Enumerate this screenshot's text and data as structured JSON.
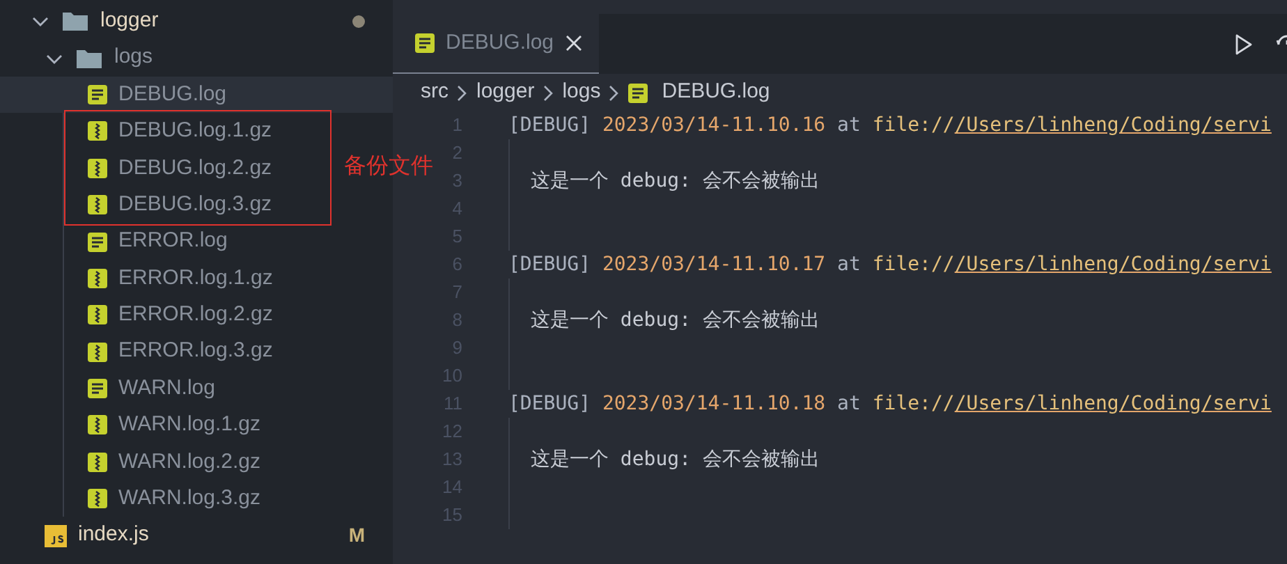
{
  "sidebar": {
    "tree": [
      {
        "label": "logger",
        "kind": "folder",
        "expanded": true,
        "modified_dot": true,
        "children": [
          {
            "label": "logs",
            "kind": "folder",
            "expanded": true,
            "children": [
              {
                "label": "DEBUG.log",
                "kind": "log",
                "selected": true,
                "in_annotation": false
              },
              {
                "label": "DEBUG.log.1.gz",
                "kind": "archive",
                "selected": false,
                "in_annotation": true
              },
              {
                "label": "DEBUG.log.2.gz",
                "kind": "archive",
                "selected": false,
                "in_annotation": true
              },
              {
                "label": "DEBUG.log.3.gz",
                "kind": "archive",
                "selected": false,
                "in_annotation": true
              },
              {
                "label": "ERROR.log",
                "kind": "log",
                "selected": false,
                "in_annotation": false
              },
              {
                "label": "ERROR.log.1.gz",
                "kind": "archive",
                "selected": false,
                "in_annotation": false
              },
              {
                "label": "ERROR.log.2.gz",
                "kind": "archive",
                "selected": false,
                "in_annotation": false
              },
              {
                "label": "ERROR.log.3.gz",
                "kind": "archive",
                "selected": false,
                "in_annotation": false
              },
              {
                "label": "WARN.log",
                "kind": "log",
                "selected": false,
                "in_annotation": false
              },
              {
                "label": "WARN.log.1.gz",
                "kind": "archive",
                "selected": false,
                "in_annotation": false
              },
              {
                "label": "WARN.log.2.gz",
                "kind": "archive",
                "selected": false,
                "in_annotation": false
              },
              {
                "label": "WARN.log.3.gz",
                "kind": "archive",
                "selected": false,
                "in_annotation": false
              }
            ]
          },
          {
            "label": "index.js",
            "kind": "js",
            "badge": "M"
          }
        ]
      }
    ],
    "annotation_label": "备份文件"
  },
  "tabs": [
    {
      "label": "DEBUG.log",
      "selected": true
    }
  ],
  "breadcrumb": [
    "src",
    "logger",
    "logs",
    "DEBUG.log"
  ],
  "editor": {
    "lines": [
      {
        "number": "1",
        "kind": "log",
        "tag": "[DEBUG]",
        "timestamp": "2023/03/14-11.10.16",
        "at": "at",
        "scheme": "file://",
        "path": "/Users/linheng/Coding/servi"
      },
      {
        "number": "2",
        "kind": "blank"
      },
      {
        "number": "3",
        "kind": "message",
        "text": "这是一个 debug: 会不会被输出"
      },
      {
        "number": "4",
        "kind": "blank"
      },
      {
        "number": "5",
        "kind": "blank"
      },
      {
        "number": "6",
        "kind": "log",
        "tag": "[DEBUG]",
        "timestamp": "2023/03/14-11.10.17",
        "at": "at",
        "scheme": "file://",
        "path": "/Users/linheng/Coding/servi"
      },
      {
        "number": "7",
        "kind": "blank"
      },
      {
        "number": "8",
        "kind": "message",
        "text": "这是一个 debug: 会不会被输出"
      },
      {
        "number": "9",
        "kind": "blank"
      },
      {
        "number": "10",
        "kind": "blank"
      },
      {
        "number": "11",
        "kind": "log",
        "tag": "[DEBUG]",
        "timestamp": "2023/03/14-11.10.18",
        "at": "at",
        "scheme": "file://",
        "path": "/Users/linheng/Coding/servi"
      },
      {
        "number": "12",
        "kind": "blank"
      },
      {
        "number": "13",
        "kind": "message",
        "text": "这是一个 debug: 会不会被输出"
      },
      {
        "number": "14",
        "kind": "blank"
      },
      {
        "number": "15",
        "kind": "blank"
      }
    ]
  }
}
